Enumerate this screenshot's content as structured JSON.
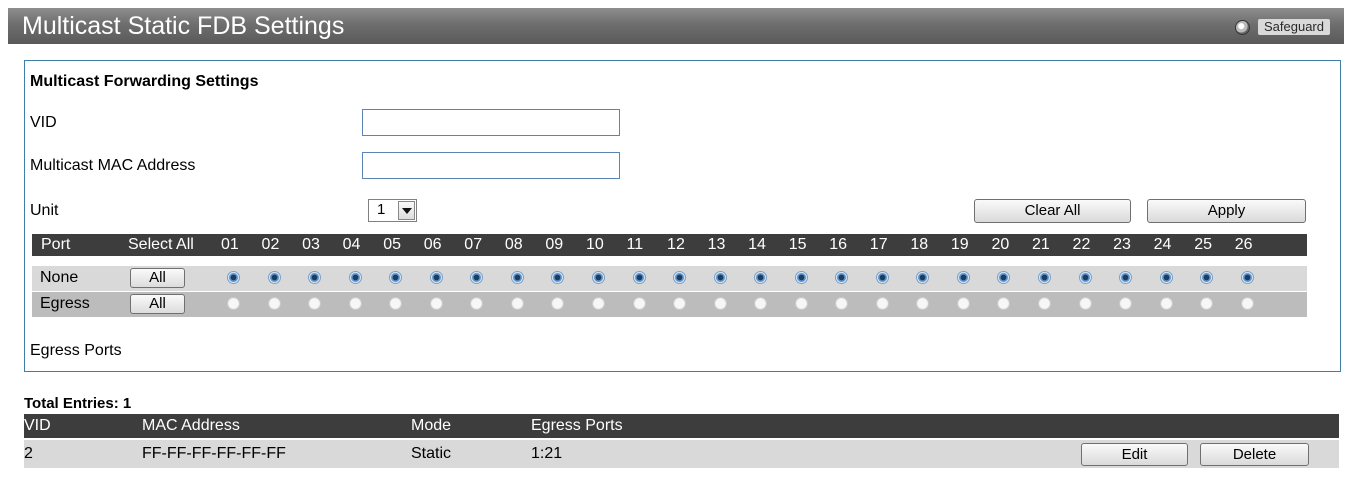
{
  "title": "Multicast Static FDB Settings",
  "safeguard": "Safeguard",
  "form": {
    "section_title": "Multicast Forwarding Settings",
    "vid_label": "VID",
    "vid_value": "",
    "mac_label": "Multicast MAC Address",
    "mac_value": "",
    "unit_label": "Unit",
    "unit_value": "1",
    "clear_all_label": "Clear All",
    "apply_label": "Apply",
    "egress_ports_label": "Egress Ports"
  },
  "port_grid": {
    "port_header": "Port",
    "select_all_header": "Select All",
    "ports": [
      "01",
      "02",
      "03",
      "04",
      "05",
      "06",
      "07",
      "08",
      "09",
      "10",
      "11",
      "12",
      "13",
      "14",
      "15",
      "16",
      "17",
      "18",
      "19",
      "20",
      "21",
      "22",
      "23",
      "24",
      "25",
      "26"
    ],
    "rows": [
      {
        "label": "None",
        "button": "All",
        "selected": true
      },
      {
        "label": "Egress",
        "button": "All",
        "selected": false
      }
    ]
  },
  "table": {
    "total_entries": "Total Entries: 1",
    "headers": [
      "VID",
      "MAC Address",
      "Mode",
      "Egress Ports"
    ],
    "rows": [
      {
        "vid": "2",
        "mac": "FF-FF-FF-FF-FF-FF",
        "mode": "Static",
        "egress": "1:21",
        "edit": "Edit",
        "delete": "Delete"
      }
    ]
  },
  "colors": {
    "title_bar": "#6e6e6e",
    "panel_border": "#3e7eaa",
    "header_bg": "#3d3d3d",
    "row_none": "#d9d9d9",
    "row_egress": "#bcbcbc"
  }
}
